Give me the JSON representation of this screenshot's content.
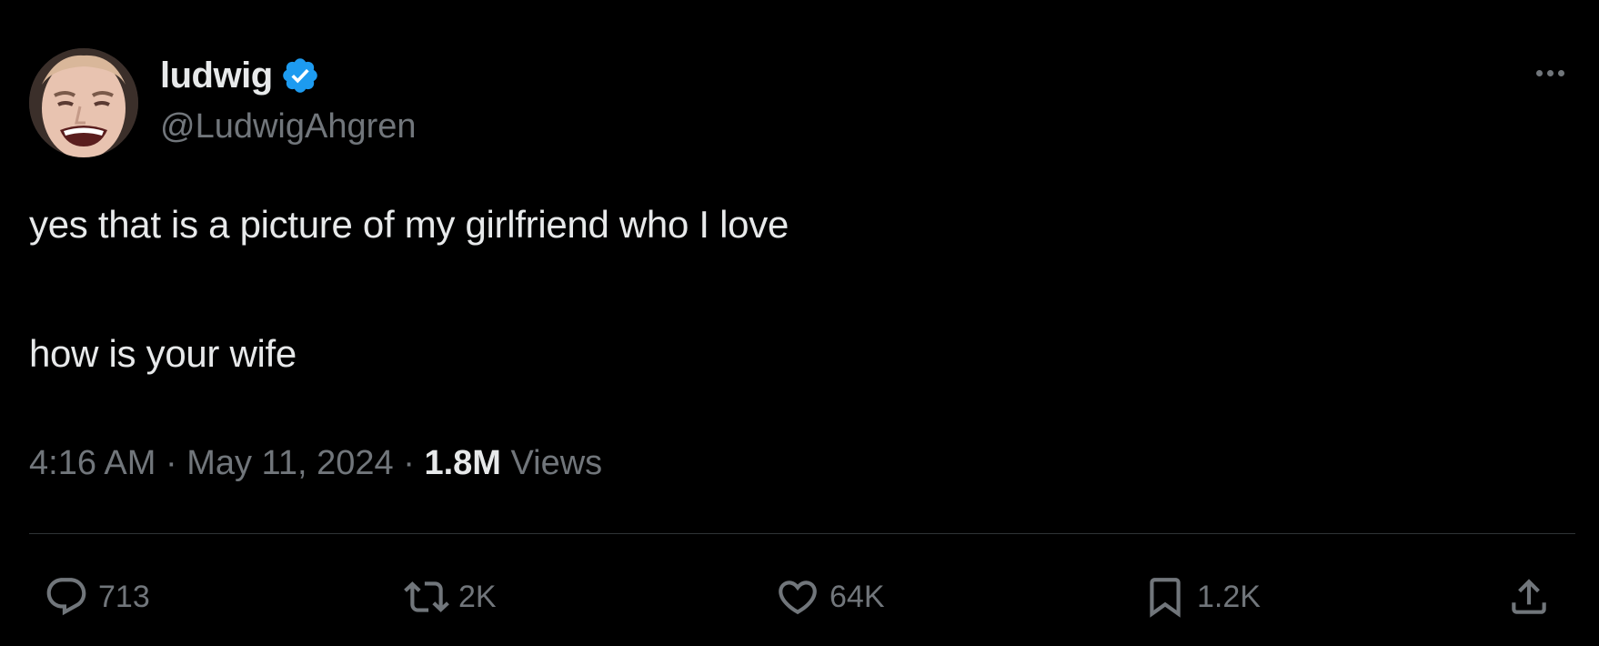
{
  "author": {
    "display_name": "ludwig",
    "handle": "@LudwigAhgren",
    "verified_icon": "verified-badge-icon",
    "avatar": "avatar"
  },
  "tweet": {
    "line1": "yes that is a picture of my girlfriend who I love",
    "line2": "how is your wife"
  },
  "meta": {
    "time": "4:16 AM",
    "separator1": "·",
    "date": "May 11, 2024",
    "separator2": "·",
    "views_count": "1.8M",
    "views_label": "Views"
  },
  "actions": {
    "reply_count": "713",
    "repost_count": "2K",
    "like_count": "64K",
    "bookmark_count": "1.2K"
  },
  "colors": {
    "background": "#000000",
    "text_primary": "#e7e9ea",
    "text_secondary": "#71767b",
    "verified_blue": "#1d9bf0",
    "divider": "#2f3336"
  }
}
